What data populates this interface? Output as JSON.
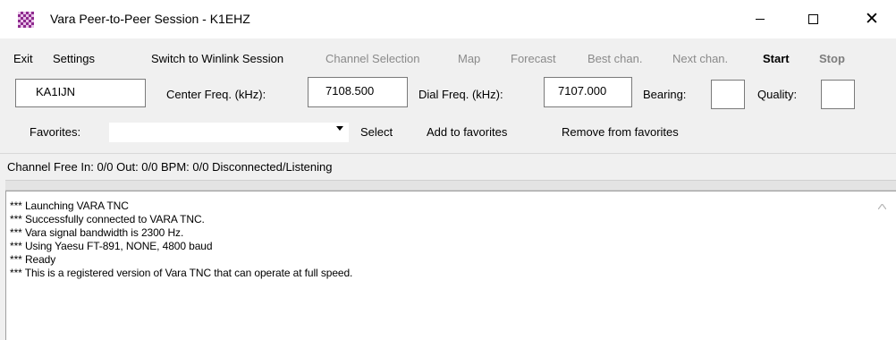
{
  "window": {
    "title": "Vara Peer-to-Peer Session - K1EHZ",
    "close_glyph": "✕",
    "icons": {
      "app": "checkered-app-icon",
      "minimize": "minimize-icon",
      "maximize": "maximize-icon",
      "close": "close-icon"
    }
  },
  "menu": {
    "exit": "Exit",
    "settings": "Settings",
    "switch": "Switch to Winlink Session",
    "channel_selection": "Channel Selection",
    "map": "Map",
    "forecast": "Forecast",
    "best_chan": "Best chan.",
    "next_chan": "Next chan.",
    "start": "Start",
    "stop": "Stop"
  },
  "fields": {
    "callsign": "KA1IJN",
    "center_freq_label": "Center Freq. (kHz):",
    "center_freq": "7108.500",
    "dial_freq_label": "Dial Freq. (kHz):",
    "dial_freq": "7107.000",
    "bearing_label": "Bearing:",
    "bearing": "",
    "quality_label": "Quality:",
    "quality": ""
  },
  "favorites": {
    "label": "Favorites:",
    "selected": "",
    "select": "Select",
    "add": "Add to favorites",
    "remove": "Remove from favorites",
    "arrow_icon": "dropdown-arrow-icon"
  },
  "status": {
    "text": "Channel Free  In: 0/0  Out: 0/0  BPM: 0/0  Disconnected/Listening"
  },
  "log": {
    "lines": [
      "*** Launching VARA TNC",
      "*** Successfully connected to VARA TNC.",
      "*** Vara signal bandwidth is 2300 Hz.",
      "*** Using Yaesu FT-891, NONE, 4800 baud",
      "*** Ready",
      "*** This is a registered version of Vara TNC that can operate at full speed."
    ]
  },
  "colors": {
    "background": "#f0f0f0",
    "disabled_text": "#8a8a8a",
    "app_icon": "#8e2a8e"
  }
}
